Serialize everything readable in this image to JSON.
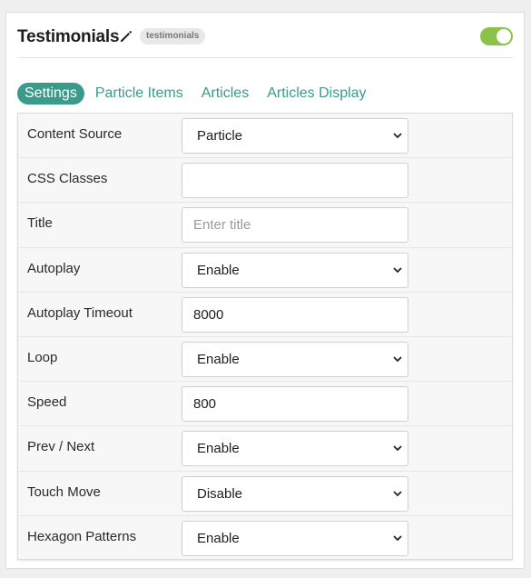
{
  "header": {
    "title": "Testimonials",
    "badge": "testimonials",
    "toggle_color": "#8bc34a"
  },
  "tabs": [
    {
      "label": "Settings",
      "active": true
    },
    {
      "label": "Particle Items",
      "active": false
    },
    {
      "label": "Articles",
      "active": false
    },
    {
      "label": "Articles Display",
      "active": false
    }
  ],
  "fields": {
    "content_source": {
      "label": "Content Source",
      "value": "Particle"
    },
    "css_classes": {
      "label": "CSS Classes",
      "value": "",
      "placeholder": ""
    },
    "title": {
      "label": "Title",
      "value": "",
      "placeholder": "Enter title"
    },
    "autoplay": {
      "label": "Autoplay",
      "value": "Enable"
    },
    "autoplay_timeout": {
      "label": "Autoplay Timeout",
      "value": "8000"
    },
    "loop": {
      "label": "Loop",
      "value": "Enable"
    },
    "speed": {
      "label": "Speed",
      "value": "800"
    },
    "prev_next": {
      "label": "Prev / Next",
      "value": "Enable"
    },
    "touch_move": {
      "label": "Touch Move",
      "value": "Disable"
    },
    "hexagon_patterns": {
      "label": "Hexagon Patterns",
      "value": "Enable"
    }
  },
  "colors": {
    "accent": "#3a9b8a",
    "toggle_on": "#8bc34a"
  }
}
